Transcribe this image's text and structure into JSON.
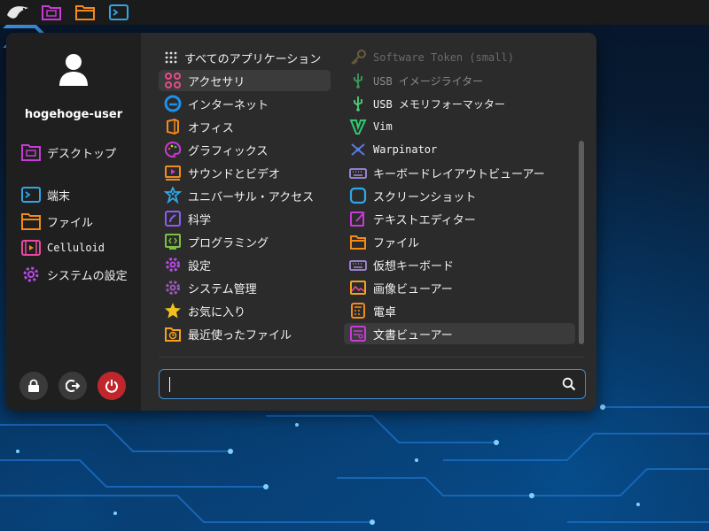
{
  "user": {
    "name": "hogehoge-user"
  },
  "sidebar": {
    "places": [
      {
        "label": "デスクトップ",
        "icon": "desktop-folder-icon"
      },
      {
        "label": "端末",
        "icon": "terminal-icon"
      },
      {
        "label": "ファイル",
        "icon": "files-icon"
      },
      {
        "label": "Celluloid",
        "icon": "celluloid-icon"
      },
      {
        "label": "システムの設定",
        "icon": "settings-icon"
      }
    ],
    "actions": [
      "lock-icon",
      "logout-icon",
      "power-icon"
    ]
  },
  "categories": [
    {
      "label": "すべてのアプリケーション",
      "icon": "grid-icon"
    },
    {
      "label": "アクセサリ",
      "icon": "accessories-icon",
      "selected": true
    },
    {
      "label": "インターネット",
      "icon": "internet-icon"
    },
    {
      "label": "オフィス",
      "icon": "office-icon"
    },
    {
      "label": "グラフィックス",
      "icon": "graphics-icon"
    },
    {
      "label": "サウンドとビデオ",
      "icon": "multimedia-icon"
    },
    {
      "label": "ユニバーサル・アクセス",
      "icon": "accessibility-icon"
    },
    {
      "label": "科学",
      "icon": "science-icon"
    },
    {
      "label": "プログラミング",
      "icon": "programming-icon"
    },
    {
      "label": "設定",
      "icon": "settings-icon"
    },
    {
      "label": "システム管理",
      "icon": "system-admin-icon"
    },
    {
      "label": "お気に入り",
      "icon": "favorites-star-icon"
    },
    {
      "label": "最近使ったファイル",
      "icon": "recent-files-icon"
    }
  ],
  "apps": [
    {
      "label": "Software Token (small)",
      "icon": "key-icon"
    },
    {
      "label": "USB イメージライター",
      "icon": "usb-icon"
    },
    {
      "label": "USB メモリフォーマッター",
      "icon": "usb-icon"
    },
    {
      "label": "Vim",
      "icon": "vim-icon"
    },
    {
      "label": "Warpinator",
      "icon": "warpinator-icon"
    },
    {
      "label": "キーボードレイアウトビューアー",
      "icon": "keyboard-icon"
    },
    {
      "label": "スクリーンショット",
      "icon": "screenshot-icon"
    },
    {
      "label": "テキストエディター",
      "icon": "text-editor-icon"
    },
    {
      "label": "ファイル",
      "icon": "files-icon"
    },
    {
      "label": "仮想キーボード",
      "icon": "keyboard-icon"
    },
    {
      "label": "画像ビューアー",
      "icon": "image-viewer-icon"
    },
    {
      "label": "電卓",
      "icon": "calculator-icon"
    },
    {
      "label": "文書ビューアー",
      "icon": "document-viewer-icon",
      "selected": true
    }
  ],
  "search": {
    "value": "",
    "placeholder": ""
  },
  "colors": {
    "accent": "#3d8fd6",
    "power": "#c0272d",
    "menu_bg": "#2b2b2b",
    "sidebar_bg": "#1f1f1f",
    "topbar_bg": "#1b1b1b"
  }
}
